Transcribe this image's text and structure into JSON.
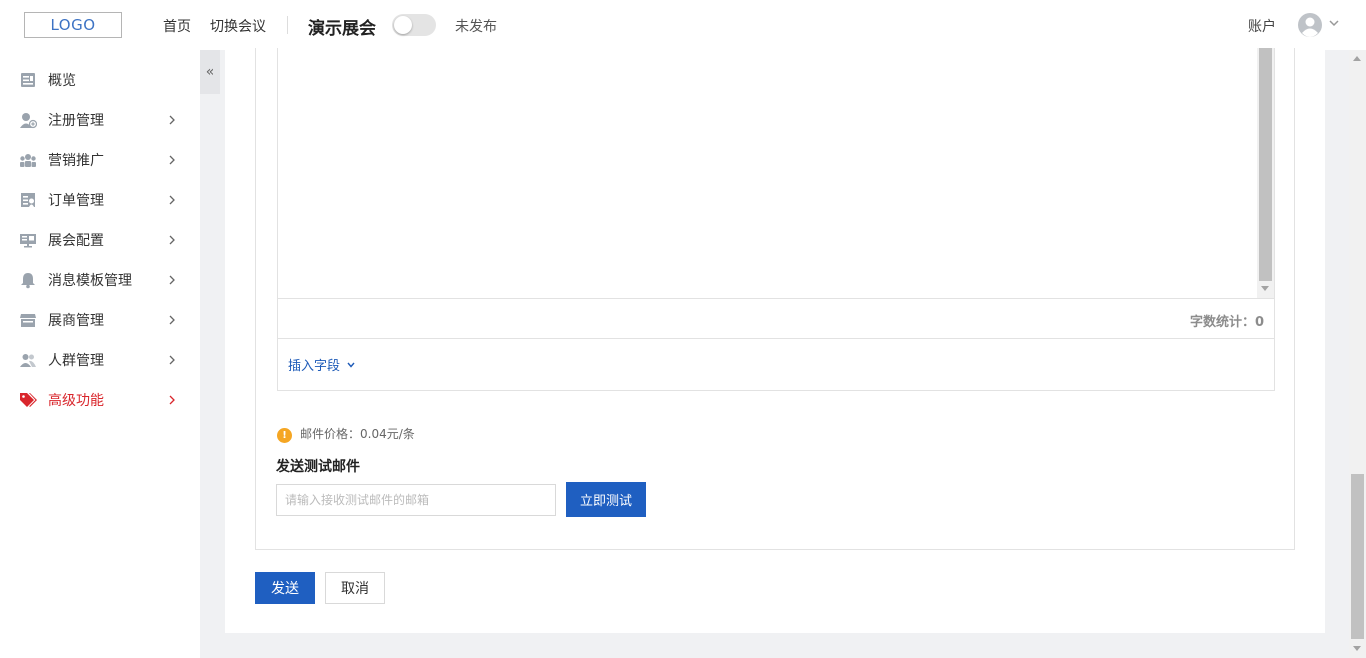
{
  "header": {
    "logo_text": "LOGO",
    "nav": [
      {
        "label": "首页"
      },
      {
        "label": "切换会议"
      }
    ],
    "event_title": "演示展会",
    "publish_toggle": {
      "on": false
    },
    "publish_status": "未发布",
    "account_label": "账户",
    "avatar_icon": "user-circle-icon"
  },
  "sidebar": {
    "collapse_symbol": "«",
    "items": [
      {
        "label": "概览",
        "icon": "overview-icon",
        "has_arrow": false,
        "active": false
      },
      {
        "label": "注册管理",
        "icon": "user-register-icon",
        "has_arrow": true,
        "active": false
      },
      {
        "label": "营销推广",
        "icon": "people-group-icon",
        "has_arrow": true,
        "active": false
      },
      {
        "label": "订单管理",
        "icon": "order-icon",
        "has_arrow": true,
        "active": false
      },
      {
        "label": "展会配置",
        "icon": "monitor-icon",
        "has_arrow": true,
        "active": false
      },
      {
        "label": "消息模板管理",
        "icon": "bell-icon",
        "has_arrow": true,
        "active": false
      },
      {
        "label": "展商管理",
        "icon": "store-icon",
        "has_arrow": true,
        "active": false
      },
      {
        "label": "人群管理",
        "icon": "crowd-icon",
        "has_arrow": true,
        "active": false
      },
      {
        "label": "高级功能",
        "icon": "tags-icon",
        "has_arrow": true,
        "active": true
      }
    ]
  },
  "editor": {
    "word_count_label": "字数统计：0",
    "insert_field_label": "插入字段"
  },
  "email": {
    "price_text": "邮件价格：0.04元/条",
    "test_title": "发送测试邮件",
    "test_input_value": "",
    "test_input_placeholder": "请输入接收测试邮件的邮箱",
    "test_button_label": "立即测试"
  },
  "actions": {
    "send_label": "发送",
    "cancel_label": "取消"
  },
  "colors": {
    "primary": "#1f5fc1",
    "active_menu": "#d9262c",
    "warning": "#f5a623"
  }
}
